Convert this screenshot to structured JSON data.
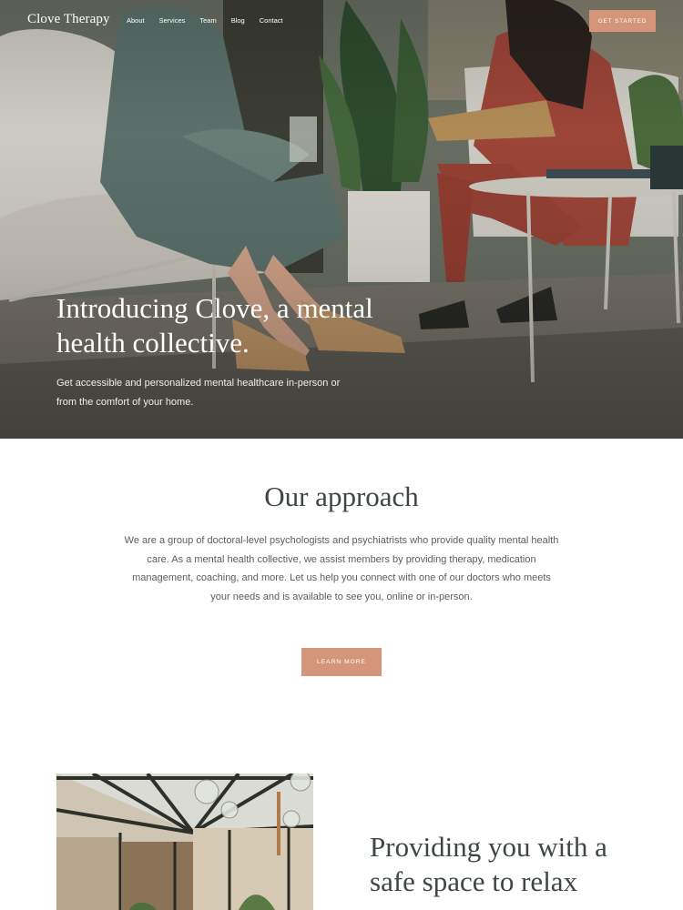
{
  "nav": {
    "brand": "Clove Therapy",
    "links": [
      "About",
      "Services",
      "Team",
      "Blog",
      "Contact"
    ],
    "cta_label": "GET STARTED"
  },
  "hero": {
    "title": "Introducing Clove, a mental health collective.",
    "subtitle": "Get accessible and personalized mental healthcare in-person or from the comfort of your home.",
    "image": "two-women-seated-in-conversation-photo"
  },
  "approach": {
    "title": "Our approach",
    "body": "We are a group of doctoral-level psychologists and psychiatrists who provide quality mental health care. As a mental health collective, we assist members by providing therapy, medication management, coaching, and more. Let us help you connect with one of our doctors who meets your needs and is available to see you, online or in-person.",
    "button_label": "LEARN MORE"
  },
  "safe_space": {
    "title": "Providing you with a safe space to relax",
    "image": "glass-atrium-interior-photo"
  },
  "colors": {
    "accent": "#d4957a",
    "heading": "#3f4745",
    "body_text": "#5a5f5c"
  }
}
